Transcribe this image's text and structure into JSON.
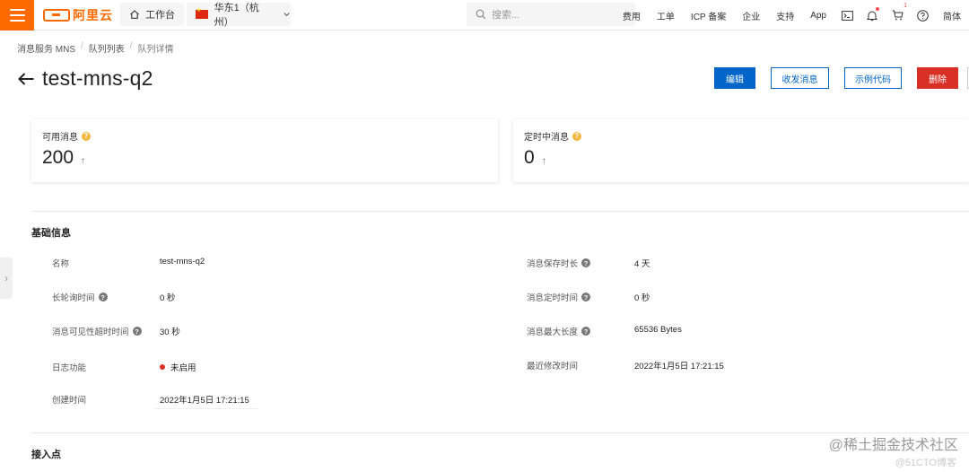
{
  "topbar": {
    "logo_text": "阿里云",
    "workbench_label": "工作台",
    "region_label": "华东1（杭州）",
    "search_placeholder": "搜索...",
    "links": [
      "费用",
      "工单",
      "ICP 备案",
      "企业",
      "支持",
      "App"
    ],
    "cart_badge": "1",
    "lang_label": "简体"
  },
  "breadcrumb": {
    "items": [
      "消息服务 MNS",
      "队列列表",
      "队列详情"
    ],
    "separator": "/"
  },
  "page": {
    "title": "test-mns-q2"
  },
  "actions": {
    "edit": "编辑",
    "send_receive": "收发消息",
    "sample_code": "示例代码",
    "delete": "删除"
  },
  "stats": {
    "available": {
      "label": "可用消息",
      "value": "200",
      "arrow": "↑"
    },
    "delayed": {
      "label": "定时中消息",
      "value": "0",
      "arrow": "↑"
    }
  },
  "basic_info": {
    "title": "基础信息",
    "left": [
      {
        "label": "名称",
        "value": "test-mns-q2"
      },
      {
        "label": "长轮询时间",
        "value": "0 秒"
      },
      {
        "label": "消息可见性超时时间",
        "value": "30 秒"
      },
      {
        "label": "日志功能",
        "value": "未启用"
      },
      {
        "label": "创建时间",
        "value": "2022年1月5日 17:21:15"
      }
    ],
    "right": [
      {
        "label": "消息保存时长",
        "value": "4 天"
      },
      {
        "label": "消息定时时间",
        "value": "0 秒"
      },
      {
        "label": "消息最大长度",
        "value": "65536 Bytes"
      },
      {
        "label": "最近修改时间",
        "value": "2022年1月5日 17:21:15"
      }
    ]
  },
  "endpoint_section": {
    "title": "接入点"
  },
  "watermark": {
    "main": "@稀土掘金技术社区",
    "sub": "@51CTO博客"
  },
  "colors": {
    "brand": "#ff6a00",
    "primary": "#0064c8",
    "danger": "#d93026",
    "help": "#f4b63f"
  }
}
